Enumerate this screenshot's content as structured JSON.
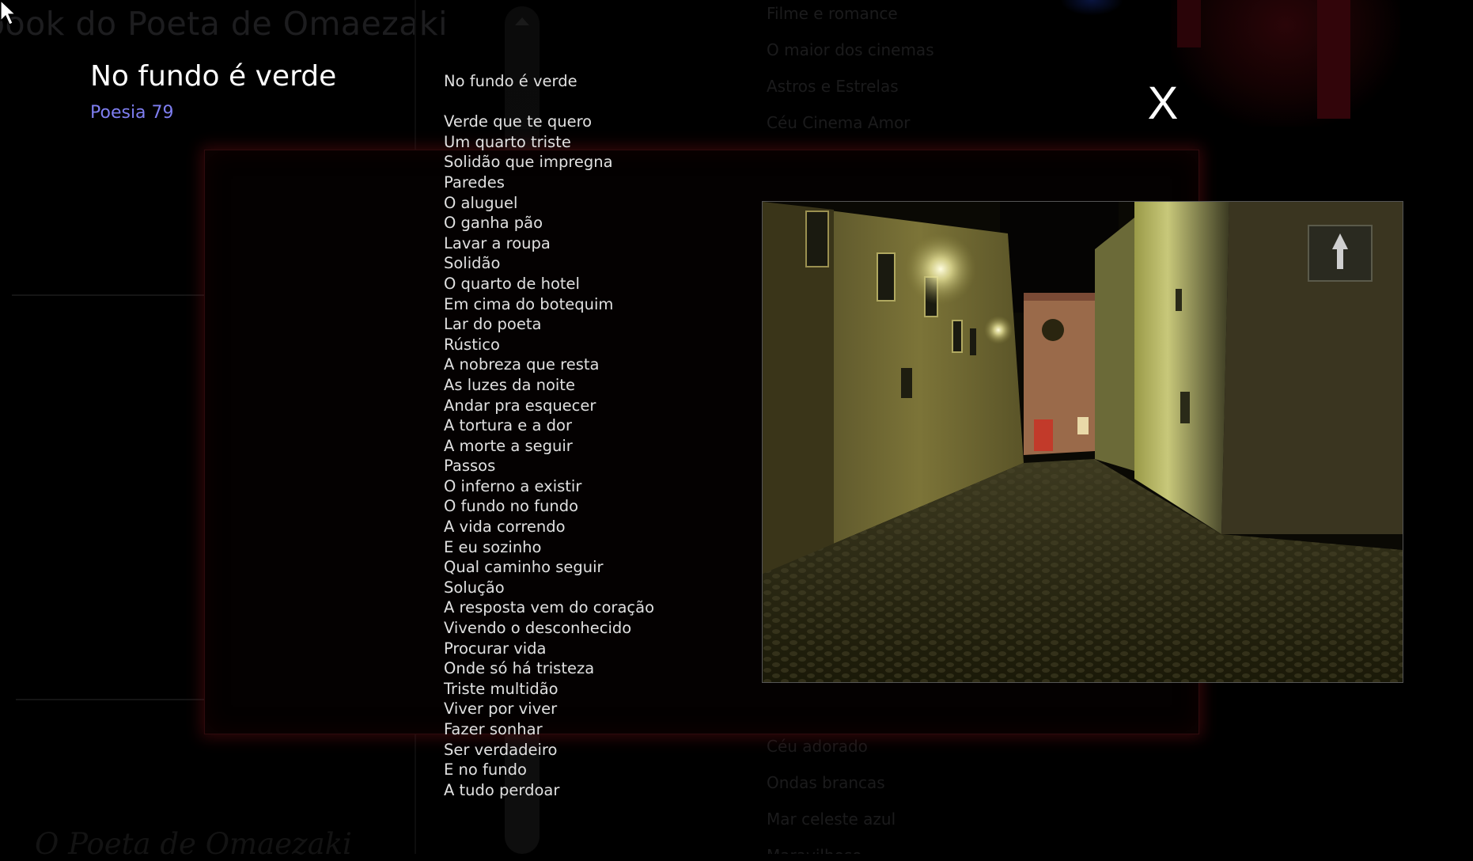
{
  "background": {
    "site_title": "book do Poeta de Omaezaki",
    "menu_top": [
      "Filme e romance",
      "O maior dos cinemas",
      "Astros e Estrelas",
      "Céu Cinema Amor"
    ],
    "menu_bottom": [
      "Céu adorado",
      "Ondas brancas",
      "Mar celeste azul",
      "Maravilhoso"
    ],
    "footer_title": "O Poeta de Omaezaki"
  },
  "poem": {
    "title": "No fundo é verde",
    "number": "Poesia 79",
    "heading": "No fundo é verde",
    "lines": [
      "Verde que te quero",
      "Um quarto triste",
      "Solidão que impregna",
      "Paredes",
      "O aluguel",
      "O ganha pão",
      "Lavar a roupa",
      "Solidão",
      "O quarto de hotel",
      "Em cima do botequim",
      "Lar do poeta",
      "Rústico",
      "A nobreza que resta",
      "As luzes da noite",
      "Andar pra esquecer",
      "A tortura e a dor",
      "A morte a seguir",
      "Passos",
      "O inferno a existir",
      "O fundo no fundo",
      "A vida correndo",
      "E eu sozinho",
      "Qual caminho seguir",
      "Solução",
      "A resposta vem do coração",
      "Vivendo o desconhecido",
      "Procurar vida",
      "Onde só há tristeza",
      "Triste multidão",
      "Viver por viver",
      "Fazer sonhar",
      "Ser verdadeiro",
      "E no fundo",
      "A tudo perdoar"
    ]
  },
  "close_label": "X",
  "photo": {
    "icon": "night-street-photo"
  },
  "colors": {
    "poem_number": "#7e7ef0",
    "panel_glow": "#6e0f14",
    "text": "#e0e0e0"
  }
}
